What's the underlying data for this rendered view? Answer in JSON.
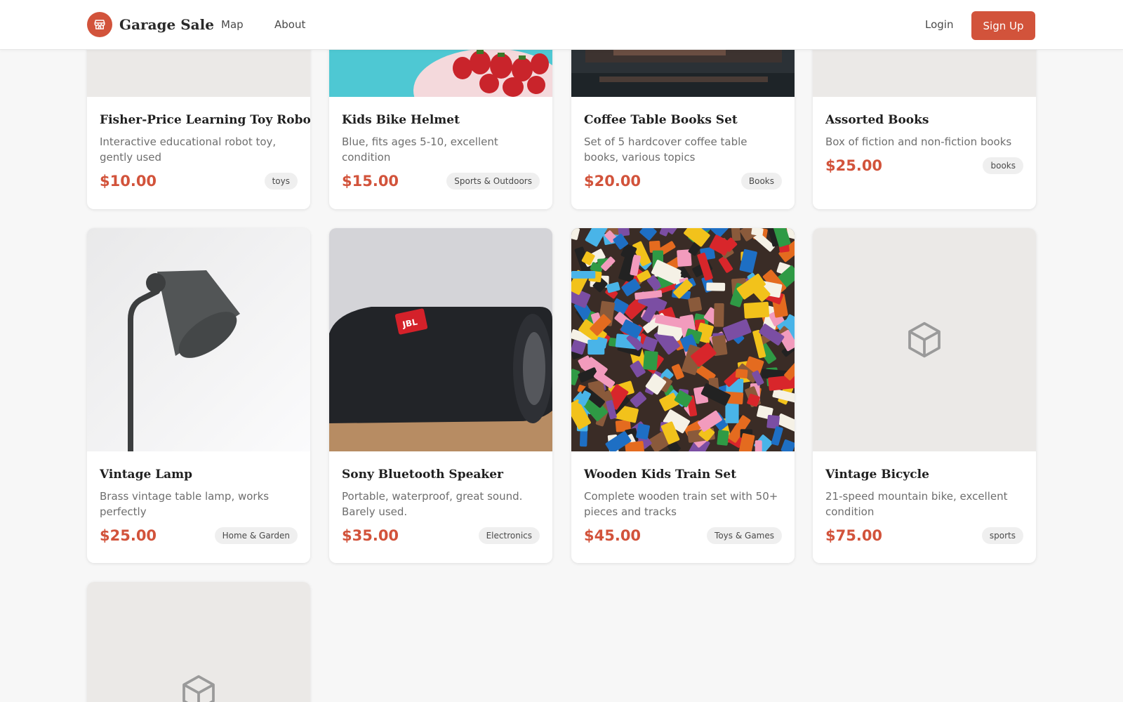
{
  "header": {
    "brand": "Garage Sale",
    "nav": [
      "Map",
      "About"
    ],
    "login": "Login",
    "signup": "Sign Up",
    "accent_color": "#d2533b"
  },
  "items": [
    {
      "title": "Fisher-Price Learning Toy Robot",
      "description": "Interactive educational robot toy, gently used",
      "price": "$10.00",
      "tag": "toys",
      "image": "placeholder-gray"
    },
    {
      "title": "Kids Bike Helmet",
      "description": "Blue, fits ages 5-10, excellent condition",
      "price": "$15.00",
      "tag": "Sports & Outdoors",
      "image": "photo-strawberries-teal"
    },
    {
      "title": "Coffee Table Books Set",
      "description": "Set of 5 hardcover coffee table books, various topics",
      "price": "$20.00",
      "tag": "Books",
      "image": "photo-dark-shelves"
    },
    {
      "title": "Assorted Books",
      "description": "Box of fiction and non-fiction books",
      "price": "$25.00",
      "tag": "books",
      "image": "placeholder-gray"
    },
    {
      "title": "Vintage Lamp",
      "description": "Brass vintage table lamp, works perfectly",
      "price": "$25.00",
      "tag": "Home & Garden",
      "image": "photo-lamp"
    },
    {
      "title": "Sony Bluetooth Speaker",
      "description": "Portable, waterproof, great sound. Barely used.",
      "price": "$35.00",
      "tag": "Electronics",
      "image": "photo-speaker"
    },
    {
      "title": "Wooden Kids Train Set",
      "description": "Complete wooden train set with 50+ pieces and tracks",
      "price": "$45.00",
      "tag": "Toys & Games",
      "image": "photo-bricks"
    },
    {
      "title": "Vintage Bicycle",
      "description": "21-speed mountain bike, excellent condition",
      "price": "$75.00",
      "tag": "sports",
      "image": "placeholder-box-icon"
    },
    {
      "image": "placeholder-box-icon"
    }
  ],
  "speaker_logo": "JBL",
  "icons": {
    "logo": "storefront-icon",
    "placeholder": "box-icon"
  }
}
